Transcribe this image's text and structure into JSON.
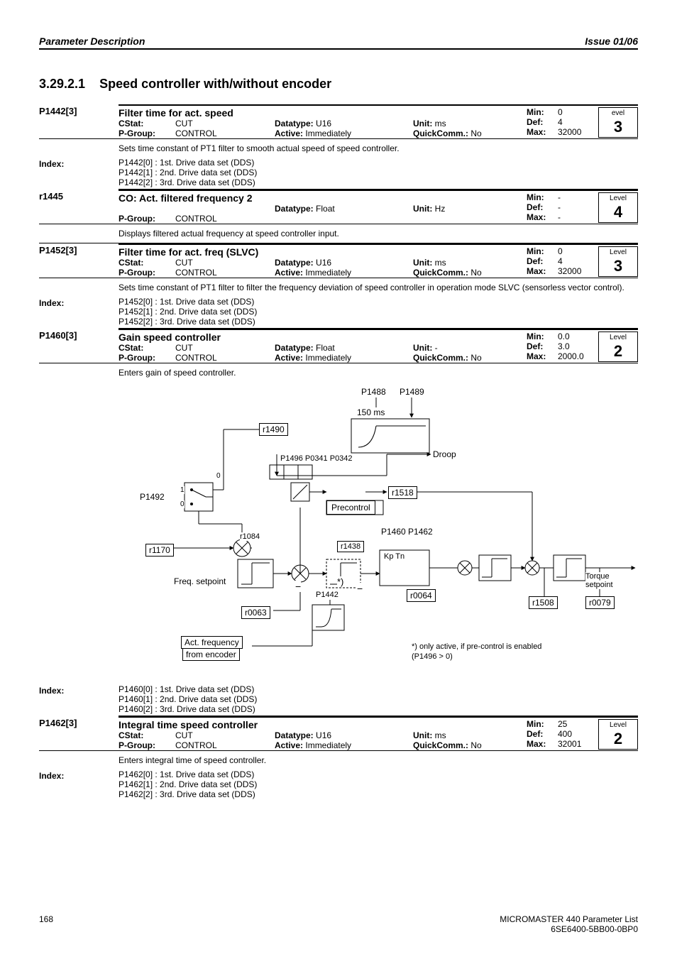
{
  "header": {
    "left": "Parameter Description",
    "right": "Issue 01/06"
  },
  "section_number": "3.29.2.1",
  "section_title": "Speed controller with/without encoder",
  "params": {
    "p1442": {
      "id": "P1442[3]",
      "title": "Filter time for act. speed",
      "cstat": "CUT",
      "pgroup": "CONTROL",
      "datatype": "U16",
      "active": "Immediately",
      "unit": "ms",
      "quickcomm": "No",
      "min": "0",
      "def": "4",
      "max": "32000",
      "level_text": "evel",
      "level": "3",
      "desc": "Sets time constant of PT1 filter to smooth actual speed of speed controller.",
      "idx": [
        "P1442[0]  :  1st. Drive data set (DDS)",
        "P1442[1]  :  2nd. Drive data set (DDS)",
        "P1442[2]  :  3rd. Drive data set (DDS)"
      ]
    },
    "r1445": {
      "id": "r1445",
      "title": "CO: Act. filtered frequency 2",
      "pgroup": "CONTROL",
      "datatype": "Float",
      "unit": "Hz",
      "min": "-",
      "def": "-",
      "max": "-",
      "level_text": "Level",
      "level": "4",
      "desc": "Displays filtered actual frequency at speed controller input."
    },
    "p1452": {
      "id": "P1452[3]",
      "title": "Filter time for act. freq (SLVC)",
      "cstat": "CUT",
      "pgroup": "CONTROL",
      "datatype": "U16",
      "active": "Immediately",
      "unit": "ms",
      "quickcomm": "No",
      "min": "0",
      "def": "4",
      "max": "32000",
      "level_text": "Level",
      "level": "3",
      "desc": "Sets time constant of PT1 filter to filter the frequency deviation of speed controller in operation mode SLVC (sensorless vector control).",
      "idx": [
        "P1452[0]  :  1st. Drive data set (DDS)",
        "P1452[1]  :  2nd. Drive data set (DDS)",
        "P1452[2]  :  3rd. Drive data set (DDS)"
      ]
    },
    "p1460": {
      "id": "P1460[3]",
      "title": "Gain speed controller",
      "cstat": "CUT",
      "pgroup": "CONTROL",
      "datatype": "Float",
      "active": "Immediately",
      "unit": "-",
      "quickcomm": "No",
      "min": "0.0",
      "def": "3.0",
      "max": "2000.0",
      "level_text": "Level",
      "level": "2",
      "desc": "Enters gain of speed controller.",
      "idx": [
        "P1460[0]  :  1st. Drive data set (DDS)",
        "P1460[1]  :  2nd. Drive data set (DDS)",
        "P1460[2]  :  3rd. Drive data set (DDS)"
      ]
    },
    "p1462": {
      "id": "P1462[3]",
      "title": "Integral time speed controller",
      "cstat": "CUT",
      "pgroup": "CONTROL",
      "datatype": "U16",
      "active": "Immediately",
      "unit": "ms",
      "quickcomm": "No",
      "min": "25",
      "def": "400",
      "max": "32001",
      "level_text": "Level",
      "level": "2",
      "desc": "Enters integral time of speed controller.",
      "idx": [
        "P1462[0]  :  1st. Drive data set (DDS)",
        "P1462[1]  :  2nd. Drive data set (DDS)",
        "P1462[2]  :  3rd. Drive data set (DDS)"
      ]
    }
  },
  "labels": {
    "index": "Index:",
    "cstat": "CStat:",
    "pgroup": "P-Group:",
    "datatype": "Datatype:",
    "active": "Active:",
    "unit": "Unit:",
    "quickcomm": "QuickComm.:",
    "min": "Min:",
    "def": "Def:",
    "max": "Max:"
  },
  "diagram": {
    "p1488": "P1488",
    "p1489": "P1489",
    "t150": "150 ms",
    "r1490": "r1490",
    "droop": "Droop",
    "p1496": "P1496 P0341 P0342",
    "precontrol": "Precontrol",
    "r1518": "r1518",
    "p1460": "P1460  P1462",
    "r1084": "r1084",
    "r1438": "r1438",
    "kptn": "Kp       Tn",
    "r1170": "r1170",
    "p1492": "P1492",
    "freq": "Freq. setpoint",
    "r0063": "r0063",
    "r0064": "r0064",
    "p1442": "P1442",
    "act": "Act. frequency",
    "from": "from encoder",
    "r1508": "r1508",
    "r0079": "r0079",
    "torque": "Torque",
    "setpoint": "setpoint",
    "note1": "*)  only active, if pre-control is enabled",
    "note2": "    (P1496 > 0)",
    "zero": "0",
    "one": "1",
    "zerob": "0"
  },
  "footer": {
    "page": "168",
    "line1": "MICROMASTER 440    Parameter List",
    "line2": "6SE6400-5BB00-0BP0"
  }
}
